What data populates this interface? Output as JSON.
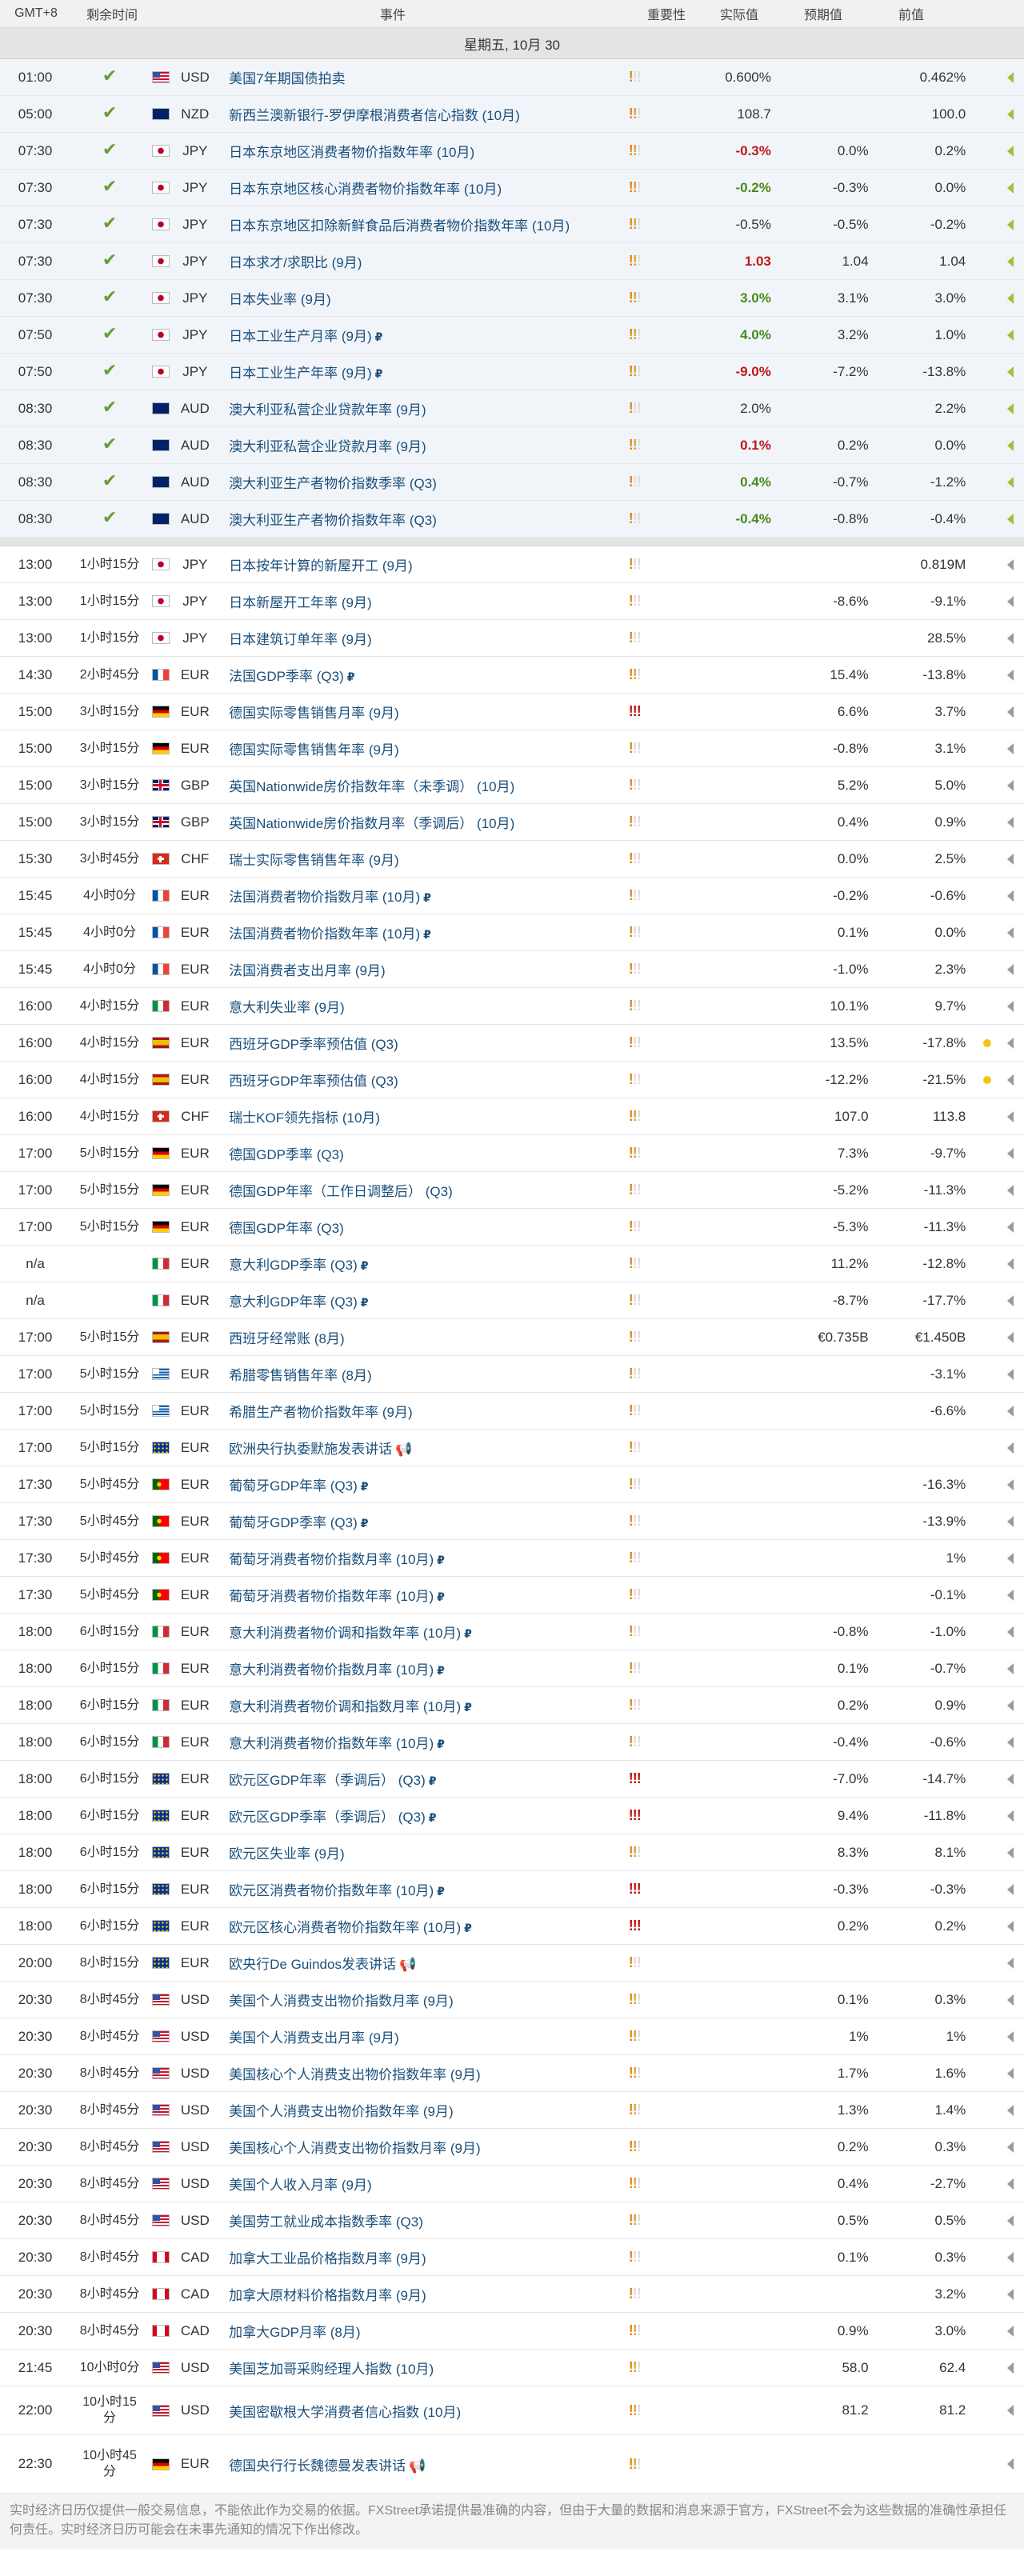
{
  "header": {
    "tz": "GMT+8",
    "remaining": "剩余时间",
    "event": "事件",
    "importance": "重要性",
    "actual": "实际值",
    "consensus": "预期值",
    "previous": "前值"
  },
  "date_label": "星期五, 10月 30",
  "colors": {
    "green": "#6b9e2e",
    "red": "#c01818",
    "link": "#1b4f7a",
    "orange": "#e08a1e",
    "yellow": "#f0c419"
  },
  "icons": {
    "done": "check-icon",
    "revised": "revised-p-icon",
    "speech": "speaker-icon",
    "arrow": "expand-arrow-icon"
  },
  "released": [
    {
      "time": "01:00",
      "flag": "us",
      "cur": "USD",
      "event": "美国7年期国债拍卖",
      "imp": 1,
      "actual": "0.600%",
      "ac": "",
      "cons": "",
      "prev": "0.462%"
    },
    {
      "time": "05:00",
      "flag": "nz",
      "cur": "NZD",
      "event": "新西兰澳新银行-罗伊摩根消费者信心指数 (10月)",
      "imp": 2,
      "actual": "108.7",
      "ac": "",
      "cons": "",
      "prev": "100.0"
    },
    {
      "time": "07:30",
      "flag": "jp",
      "cur": "JPY",
      "event": "日本东京地区消费者物价指数年率 (10月)",
      "imp": 2,
      "actual": "-0.3%",
      "ac": "neg",
      "cons": "0.0%",
      "prev": "0.2%"
    },
    {
      "time": "07:30",
      "flag": "jp",
      "cur": "JPY",
      "event": "日本东京地区核心消费者物价指数年率 (10月)",
      "imp": 2,
      "actual": "-0.2%",
      "ac": "pos",
      "cons": "-0.3%",
      "prev": "0.0%"
    },
    {
      "time": "07:30",
      "flag": "jp",
      "cur": "JPY",
      "event": "日本东京地区扣除新鲜食品后消费者物价指数年率 (10月)",
      "imp": 2,
      "actual": "-0.5%",
      "ac": "",
      "cons": "-0.5%",
      "prev": "-0.2%"
    },
    {
      "time": "07:30",
      "flag": "jp",
      "cur": "JPY",
      "event": "日本求才/求职比 (9月)",
      "imp": 2,
      "actual": "1.03",
      "ac": "neg",
      "cons": "1.04",
      "prev": "1.04"
    },
    {
      "time": "07:30",
      "flag": "jp",
      "cur": "JPY",
      "event": "日本失业率 (9月)",
      "imp": 2,
      "actual": "3.0%",
      "ac": "pos",
      "cons": "3.1%",
      "prev": "3.0%"
    },
    {
      "time": "07:50",
      "flag": "jp",
      "cur": "JPY",
      "event": "日本工业生产月率 (9月)",
      "imp": 2,
      "rev": true,
      "actual": "4.0%",
      "ac": "pos",
      "cons": "3.2%",
      "prev": "1.0%"
    },
    {
      "time": "07:50",
      "flag": "jp",
      "cur": "JPY",
      "event": "日本工业生产年率 (9月)",
      "imp": 2,
      "rev": true,
      "actual": "-9.0%",
      "ac": "neg",
      "cons": "-7.2%",
      "prev": "-13.8%"
    },
    {
      "time": "08:30",
      "flag": "au",
      "cur": "AUD",
      "event": "澳大利亚私营企业贷款年率 (9月)",
      "imp": 1,
      "actual": "2.0%",
      "ac": "",
      "cons": "",
      "prev": "2.2%"
    },
    {
      "time": "08:30",
      "flag": "au",
      "cur": "AUD",
      "event": "澳大利亚私营企业贷款月率 (9月)",
      "imp": 2,
      "actual": "0.1%",
      "ac": "neg",
      "cons": "0.2%",
      "prev": "0.0%"
    },
    {
      "time": "08:30",
      "flag": "au",
      "cur": "AUD",
      "event": "澳大利亚生产者物价指数季率 (Q3)",
      "imp": 1,
      "actual": "0.4%",
      "ac": "pos",
      "cons": "-0.7%",
      "prev": "-1.2%"
    },
    {
      "time": "08:30",
      "flag": "au",
      "cur": "AUD",
      "event": "澳大利亚生产者物价指数年率 (Q3)",
      "imp": 1,
      "actual": "-0.4%",
      "ac": "pos",
      "cons": "-0.8%",
      "prev": "-0.4%"
    }
  ],
  "upcoming": [
    {
      "time": "13:00",
      "rem": "1小时15分",
      "flag": "jp",
      "cur": "JPY",
      "event": "日本按年计算的新屋开工 (9月)",
      "imp": 1,
      "cons": "",
      "prev": "0.819M"
    },
    {
      "time": "13:00",
      "rem": "1小时15分",
      "flag": "jp",
      "cur": "JPY",
      "event": "日本新屋开工年率 (9月)",
      "imp": 1,
      "cons": "-8.6%",
      "prev": "-9.1%"
    },
    {
      "time": "13:00",
      "rem": "1小时15分",
      "flag": "jp",
      "cur": "JPY",
      "event": "日本建筑订单年率 (9月)",
      "imp": 1,
      "cons": "",
      "prev": "28.5%"
    },
    {
      "time": "14:30",
      "rem": "2小时45分",
      "flag": "fr",
      "cur": "EUR",
      "event": "法国GDP季率 (Q3)",
      "rev": true,
      "imp": 2,
      "cons": "15.4%",
      "prev": "-13.8%"
    },
    {
      "time": "15:00",
      "rem": "3小时15分",
      "flag": "de",
      "cur": "EUR",
      "event": "德国实际零售销售月率 (9月)",
      "imp": 3,
      "cons": "6.6%",
      "prev": "3.7%"
    },
    {
      "time": "15:00",
      "rem": "3小时15分",
      "flag": "de",
      "cur": "EUR",
      "event": "德国实际零售销售年率 (9月)",
      "imp": 1,
      "cons": "-0.8%",
      "prev": "3.1%"
    },
    {
      "time": "15:00",
      "rem": "3小时15分",
      "flag": "gb",
      "cur": "GBP",
      "event": "英国Nationwide房价指数年率（未季调） (10月)",
      "imp": 1,
      "cons": "5.2%",
      "prev": "5.0%"
    },
    {
      "time": "15:00",
      "rem": "3小时15分",
      "flag": "gb",
      "cur": "GBP",
      "event": "英国Nationwide房价指数月率（季调后） (10月)",
      "imp": 1,
      "cons": "0.4%",
      "prev": "0.9%"
    },
    {
      "time": "15:30",
      "rem": "3小时45分",
      "flag": "ch",
      "cur": "CHF",
      "event": "瑞士实际零售销售年率 (9月)",
      "imp": 1,
      "cons": "0.0%",
      "prev": "2.5%"
    },
    {
      "time": "15:45",
      "rem": "4小时0分",
      "flag": "fr",
      "cur": "EUR",
      "event": "法国消费者物价指数月率 (10月)",
      "rev": true,
      "imp": 1,
      "cons": "-0.2%",
      "prev": "-0.6%"
    },
    {
      "time": "15:45",
      "rem": "4小时0分",
      "flag": "fr",
      "cur": "EUR",
      "event": "法国消费者物价指数年率 (10月)",
      "rev": true,
      "imp": 1,
      "cons": "0.1%",
      "prev": "0.0%"
    },
    {
      "time": "15:45",
      "rem": "4小时0分",
      "flag": "fr",
      "cur": "EUR",
      "event": "法国消费者支出月率 (9月)",
      "imp": 1,
      "cons": "-1.0%",
      "prev": "2.3%"
    },
    {
      "time": "16:00",
      "rem": "4小时15分",
      "flag": "it",
      "cur": "EUR",
      "event": "意大利失业率 (9月)",
      "imp": 1,
      "cons": "10.1%",
      "prev": "9.7%"
    },
    {
      "time": "16:00",
      "rem": "4小时15分",
      "flag": "es",
      "cur": "EUR",
      "event": "西班牙GDP季率预估值 (Q3)",
      "imp": 1,
      "cons": "13.5%",
      "prev": "-17.8%",
      "dot": true
    },
    {
      "time": "16:00",
      "rem": "4小时15分",
      "flag": "es",
      "cur": "EUR",
      "event": "西班牙GDP年率预估值 (Q3)",
      "imp": 1,
      "cons": "-12.2%",
      "prev": "-21.5%",
      "dot": true
    },
    {
      "time": "16:00",
      "rem": "4小时15分",
      "flag": "ch",
      "cur": "CHF",
      "event": "瑞士KOF领先指标 (10月)",
      "imp": 2,
      "cons": "107.0",
      "prev": "113.8"
    },
    {
      "time": "17:00",
      "rem": "5小时15分",
      "flag": "de",
      "cur": "EUR",
      "event": "德国GDP季率 (Q3)",
      "imp": 2,
      "cons": "7.3%",
      "prev": "-9.7%"
    },
    {
      "time": "17:00",
      "rem": "5小时15分",
      "flag": "de",
      "cur": "EUR",
      "event": "德国GDP年率（工作日调整后） (Q3)",
      "imp": 1,
      "cons": "-5.2%",
      "prev": "-11.3%"
    },
    {
      "time": "17:00",
      "rem": "5小时15分",
      "flag": "de",
      "cur": "EUR",
      "event": "德国GDP年率 (Q3)",
      "imp": 1,
      "cons": "-5.3%",
      "prev": "-11.3%"
    },
    {
      "time": "n/a",
      "rem": "",
      "flag": "it",
      "cur": "EUR",
      "event": "意大利GDP季率 (Q3)",
      "rev": true,
      "imp": 1,
      "cons": "11.2%",
      "prev": "-12.8%"
    },
    {
      "time": "n/a",
      "rem": "",
      "flag": "it",
      "cur": "EUR",
      "event": "意大利GDP年率 (Q3)",
      "rev": true,
      "imp": 1,
      "cons": "-8.7%",
      "prev": "-17.7%"
    },
    {
      "time": "17:00",
      "rem": "5小时15分",
      "flag": "es",
      "cur": "EUR",
      "event": "西班牙经常账 (8月)",
      "imp": 1,
      "cons": "€0.735B",
      "prev": "€1.450B"
    },
    {
      "time": "17:00",
      "rem": "5小时15分",
      "flag": "gr",
      "cur": "EUR",
      "event": "希腊零售销售年率 (8月)",
      "imp": 1,
      "cons": "",
      "prev": "-3.1%"
    },
    {
      "time": "17:00",
      "rem": "5小时15分",
      "flag": "gr",
      "cur": "EUR",
      "event": "希腊生产者物价指数年率 (9月)",
      "imp": 1,
      "cons": "",
      "prev": "-6.6%"
    },
    {
      "time": "17:00",
      "rem": "5小时15分",
      "flag": "eu",
      "cur": "EUR",
      "event": "欧洲央行执委默施发表讲话",
      "spk": true,
      "imp": 1,
      "cons": "",
      "prev": ""
    },
    {
      "time": "17:30",
      "rem": "5小时45分",
      "flag": "pt",
      "cur": "EUR",
      "event": "葡萄牙GDP年率 (Q3)",
      "rev": true,
      "imp": 1,
      "cons": "",
      "prev": "-16.3%"
    },
    {
      "time": "17:30",
      "rem": "5小时45分",
      "flag": "pt",
      "cur": "EUR",
      "event": "葡萄牙GDP季率 (Q3)",
      "rev": true,
      "imp": 1,
      "cons": "",
      "prev": "-13.9%"
    },
    {
      "time": "17:30",
      "rem": "5小时45分",
      "flag": "pt",
      "cur": "EUR",
      "event": "葡萄牙消费者物价指数月率 (10月)",
      "rev": true,
      "imp": 1,
      "cons": "",
      "prev": "1%"
    },
    {
      "time": "17:30",
      "rem": "5小时45分",
      "flag": "pt",
      "cur": "EUR",
      "event": "葡萄牙消费者物价指数年率 (10月)",
      "rev": true,
      "imp": 1,
      "cons": "",
      "prev": "-0.1%"
    },
    {
      "time": "18:00",
      "rem": "6小时15分",
      "flag": "it",
      "cur": "EUR",
      "event": "意大利消费者物价调和指数年率 (10月)",
      "rev": true,
      "imp": 1,
      "cons": "-0.8%",
      "prev": "-1.0%"
    },
    {
      "time": "18:00",
      "rem": "6小时15分",
      "flag": "it",
      "cur": "EUR",
      "event": "意大利消费者物价指数月率 (10月)",
      "rev": true,
      "imp": 1,
      "cons": "0.1%",
      "prev": "-0.7%"
    },
    {
      "time": "18:00",
      "rem": "6小时15分",
      "flag": "it",
      "cur": "EUR",
      "event": "意大利消费者物价调和指数月率 (10月)",
      "rev": true,
      "imp": 1,
      "cons": "0.2%",
      "prev": "0.9%"
    },
    {
      "time": "18:00",
      "rem": "6小时15分",
      "flag": "it",
      "cur": "EUR",
      "event": "意大利消费者物价指数年率 (10月)",
      "rev": true,
      "imp": 1,
      "cons": "-0.4%",
      "prev": "-0.6%"
    },
    {
      "time": "18:00",
      "rem": "6小时15分",
      "flag": "eu",
      "cur": "EUR",
      "event": "欧元区GDP年率（季调后） (Q3)",
      "rev": true,
      "imp": 3,
      "cons": "-7.0%",
      "prev": "-14.7%"
    },
    {
      "time": "18:00",
      "rem": "6小时15分",
      "flag": "eu",
      "cur": "EUR",
      "event": "欧元区GDP季率（季调后） (Q3)",
      "rev": true,
      "imp": 3,
      "cons": "9.4%",
      "prev": "-11.8%"
    },
    {
      "time": "18:00",
      "rem": "6小时15分",
      "flag": "eu",
      "cur": "EUR",
      "event": "欧元区失业率 (9月)",
      "imp": 2,
      "cons": "8.3%",
      "prev": "8.1%"
    },
    {
      "time": "18:00",
      "rem": "6小时15分",
      "flag": "eu",
      "cur": "EUR",
      "event": "欧元区消费者物价指数年率 (10月)",
      "rev": true,
      "imp": 3,
      "cons": "-0.3%",
      "prev": "-0.3%"
    },
    {
      "time": "18:00",
      "rem": "6小时15分",
      "flag": "eu",
      "cur": "EUR",
      "event": "欧元区核心消费者物价指数年率 (10月)",
      "rev": true,
      "imp": 3,
      "cons": "0.2%",
      "prev": "0.2%"
    },
    {
      "time": "20:00",
      "rem": "8小时15分",
      "flag": "eu",
      "cur": "EUR",
      "event": "欧央行De Guindos发表讲话",
      "spk": true,
      "imp": 1,
      "cons": "",
      "prev": ""
    },
    {
      "time": "20:30",
      "rem": "8小时45分",
      "flag": "us",
      "cur": "USD",
      "event": "美国个人消费支出物价指数月率 (9月)",
      "imp": 2,
      "cons": "0.1%",
      "prev": "0.3%"
    },
    {
      "time": "20:30",
      "rem": "8小时45分",
      "flag": "us",
      "cur": "USD",
      "event": "美国个人消费支出月率 (9月)",
      "imp": 2,
      "cons": "1%",
      "prev": "1%"
    },
    {
      "time": "20:30",
      "rem": "8小时45分",
      "flag": "us",
      "cur": "USD",
      "event": "美国核心个人消费支出物价指数年率 (9月)",
      "imp": 2,
      "cons": "1.7%",
      "prev": "1.6%"
    },
    {
      "time": "20:30",
      "rem": "8小时45分",
      "flag": "us",
      "cur": "USD",
      "event": "美国个人消费支出物价指数年率 (9月)",
      "imp": 2,
      "cons": "1.3%",
      "prev": "1.4%"
    },
    {
      "time": "20:30",
      "rem": "8小时45分",
      "flag": "us",
      "cur": "USD",
      "event": "美国核心个人消费支出物价指数月率 (9月)",
      "imp": 2,
      "cons": "0.2%",
      "prev": "0.3%"
    },
    {
      "time": "20:30",
      "rem": "8小时45分",
      "flag": "us",
      "cur": "USD",
      "event": "美国个人收入月率 (9月)",
      "imp": 2,
      "cons": "0.4%",
      "prev": "-2.7%"
    },
    {
      "time": "20:30",
      "rem": "8小时45分",
      "flag": "us",
      "cur": "USD",
      "event": "美国劳工就业成本指数季率 (Q3)",
      "imp": 2,
      "cons": "0.5%",
      "prev": "0.5%"
    },
    {
      "time": "20:30",
      "rem": "8小时45分",
      "flag": "ca",
      "cur": "CAD",
      "event": "加拿大工业品价格指数月率 (9月)",
      "imp": 1,
      "cons": "0.1%",
      "prev": "0.3%"
    },
    {
      "time": "20:30",
      "rem": "8小时45分",
      "flag": "ca",
      "cur": "CAD",
      "event": "加拿大原材料价格指数月率 (9月)",
      "imp": 1,
      "cons": "",
      "prev": "3.2%"
    },
    {
      "time": "20:30",
      "rem": "8小时45分",
      "flag": "ca",
      "cur": "CAD",
      "event": "加拿大GDP月率 (8月)",
      "imp": 2,
      "cons": "0.9%",
      "prev": "3.0%"
    },
    {
      "time": "21:45",
      "rem": "10小时0分",
      "flag": "us",
      "cur": "USD",
      "event": "美国芝加哥采购经理人指数 (10月)",
      "imp": 2,
      "cons": "58.0",
      "prev": "62.4"
    },
    {
      "time": "22:00",
      "rem": "10小时15\n分",
      "flag": "us",
      "cur": "USD",
      "event": "美国密歇根大学消费者信心指数 (10月)",
      "imp": 2,
      "cons": "81.2",
      "prev": "81.2",
      "tall": "tall"
    },
    {
      "time": "22:30",
      "rem": "10小时45\n分",
      "flag": "de",
      "cur": "EUR",
      "event": "德国央行行长魏德曼发表讲话",
      "spk": true,
      "imp": 2,
      "cons": "",
      "prev": "",
      "tall": "tall2"
    }
  ],
  "footer": "实时经济日历仅提供一般交易信息，不能依此作为交易的依据。FXStreet承诺提供最准确的内容，但由于大量的数据和消息来源于官方，FXStreet不会为这些数据的准确性承担任何责任。实时经济日历可能会在未事先通知的情况下作出修改。"
}
